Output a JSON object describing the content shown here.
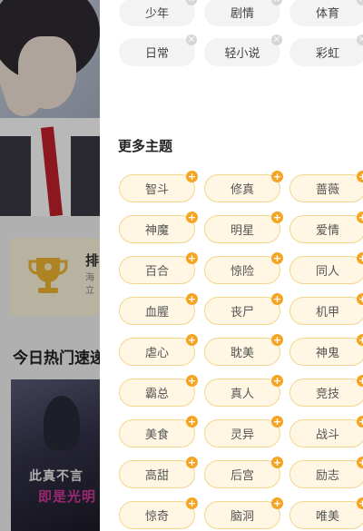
{
  "background": {
    "rank_title": "排",
    "rank_sub_1": "海",
    "rank_sub_2": "立",
    "section_title": "今日热门速递",
    "cover_title_1": "此真不言",
    "cover_title_2": "即是光明"
  },
  "drawer": {
    "top_tags": [
      {
        "label": "少年",
        "badge": "×"
      },
      {
        "label": "剧情",
        "badge": "×"
      },
      {
        "label": "体育",
        "badge": "×"
      },
      {
        "label": "日常",
        "badge": "×"
      },
      {
        "label": "轻小说",
        "badge": "×"
      },
      {
        "label": "彩虹",
        "badge": "×"
      }
    ],
    "more_title": "更多主题",
    "more_tags": [
      {
        "label": "智斗",
        "badge": "+"
      },
      {
        "label": "修真",
        "badge": "+"
      },
      {
        "label": "蔷薇",
        "badge": "+"
      },
      {
        "label": "神魔",
        "badge": "+"
      },
      {
        "label": "明星",
        "badge": "+"
      },
      {
        "label": "爱情",
        "badge": "+"
      },
      {
        "label": "百合",
        "badge": "+"
      },
      {
        "label": "惊险",
        "badge": "+"
      },
      {
        "label": "同人",
        "badge": "+"
      },
      {
        "label": "血腥",
        "badge": "+"
      },
      {
        "label": "丧尸",
        "badge": "+"
      },
      {
        "label": "机甲",
        "badge": "+"
      },
      {
        "label": "虐心",
        "badge": "+"
      },
      {
        "label": "耽美",
        "badge": "+"
      },
      {
        "label": "神鬼",
        "badge": "+"
      },
      {
        "label": "霸总",
        "badge": "+"
      },
      {
        "label": "真人",
        "badge": "+"
      },
      {
        "label": "竞技",
        "badge": "+"
      },
      {
        "label": "美食",
        "badge": "+"
      },
      {
        "label": "灵异",
        "badge": "+"
      },
      {
        "label": "战斗",
        "badge": "+"
      },
      {
        "label": "高甜",
        "badge": "+"
      },
      {
        "label": "后宫",
        "badge": "+"
      },
      {
        "label": "励志",
        "badge": "+"
      },
      {
        "label": "惊奇",
        "badge": "+"
      },
      {
        "label": "脑洞",
        "badge": "+"
      },
      {
        "label": "唯美",
        "badge": "+"
      }
    ]
  },
  "colors": {
    "accent_orange": "#f5a524",
    "tag_orange_bg": "#fff6e3",
    "tag_grey_bg": "#f3f3f3"
  }
}
